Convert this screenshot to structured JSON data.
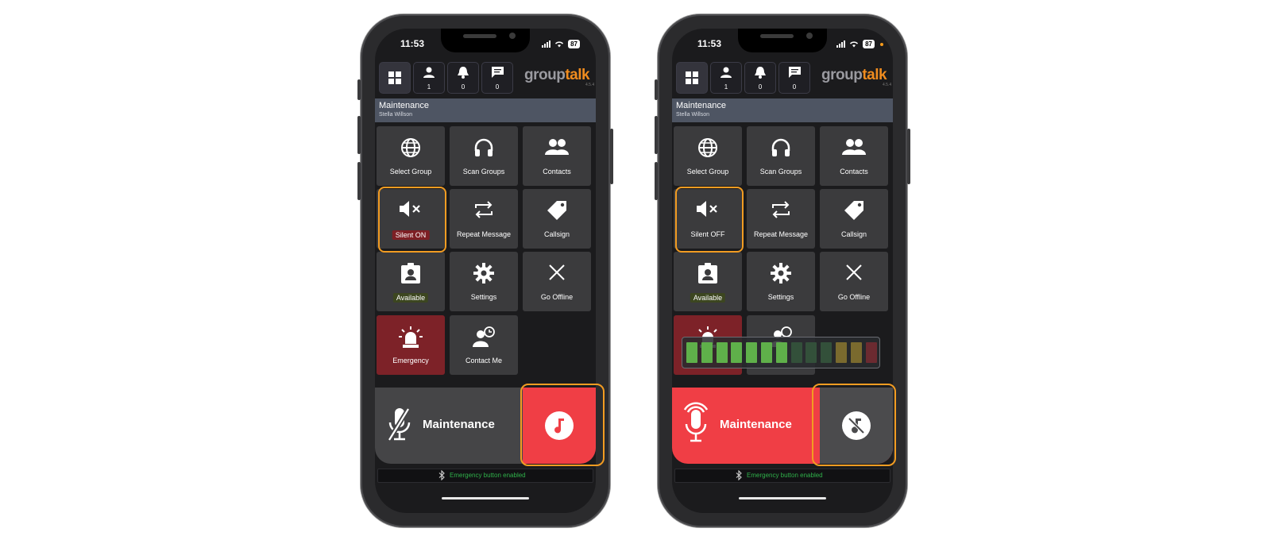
{
  "phones": [
    {
      "status": {
        "time": "11:53",
        "battery": "87"
      },
      "toolbar": {
        "contacts_count": "1",
        "alerts_count": "0",
        "messages_count": "0",
        "logo_group": "group",
        "logo_talk": "talk",
        "logo_version": "4.5.4"
      },
      "header": {
        "title": "Maintenance",
        "subtitle": "Stella Willson"
      },
      "tiles": {
        "select_group": "Select Group",
        "scan_groups": "Scan Groups",
        "contacts": "Contacts",
        "silent": "Silent ON",
        "repeat_message": "Repeat Message",
        "callsign": "Callsign",
        "available": "Available",
        "settings": "Settings",
        "go_offline": "Go Offline",
        "emergency": "Emergency",
        "contact_me": "Contact Me"
      },
      "ptt": {
        "label": "Maintenance"
      },
      "bluetooth": {
        "text": "Emergency button enabled"
      }
    },
    {
      "status": {
        "time": "11:53",
        "battery": "87"
      },
      "toolbar": {
        "contacts_count": "1",
        "alerts_count": "0",
        "messages_count": "0",
        "logo_group": "group",
        "logo_talk": "talk",
        "logo_version": "4.5.4"
      },
      "header": {
        "title": "Maintenance",
        "subtitle": "Stella Willson"
      },
      "tiles": {
        "select_group": "Select Group",
        "scan_groups": "Scan Groups",
        "contacts": "Contacts",
        "silent": "Silent OFF",
        "repeat_message": "Repeat Message",
        "callsign": "Callsign",
        "available": "Available",
        "settings": "Settings",
        "go_offline": "Go Offline"
      },
      "ptt": {
        "label": "Maintenance"
      },
      "level_meter": {
        "segments_total": 13,
        "segments_lit": 7
      },
      "bluetooth": {
        "text": "Emergency button enabled"
      }
    }
  ],
  "colors": {
    "highlight": "#f29c22",
    "ptt_live": "#f03e45",
    "logo_accent": "#f08c1e",
    "bluetooth_text": "#2fb14a"
  }
}
